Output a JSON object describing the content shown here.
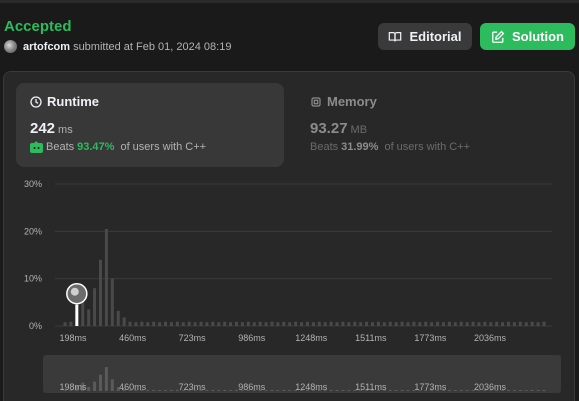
{
  "status": "Accepted",
  "submission": {
    "user": "artofcom",
    "text": "submitted at Feb 01, 2024 08:19"
  },
  "buttons": {
    "editorial": "Editorial",
    "solution": "Solution"
  },
  "runtime": {
    "title": "Runtime",
    "value": "242",
    "unit": "ms",
    "beats_label": "Beats",
    "beats_pct": "93.47%",
    "beats_suffix": "of users with C++"
  },
  "memory": {
    "title": "Memory",
    "value": "93.27",
    "unit": "MB",
    "beats_label": "Beats",
    "beats_pct": "31.99%",
    "beats_suffix": "of users with C++"
  },
  "colors": {
    "accent_green": "#2cbb5d",
    "bar": "#4a4a4a",
    "bar_mini": "#5a5a5a",
    "highlight_bar": "#ffffff"
  },
  "chart_data": {
    "type": "bar",
    "ylim": [
      0,
      30
    ],
    "yticks": [
      "30%",
      "20%",
      "10%",
      "0%"
    ],
    "ytick_values": [
      30,
      20,
      10,
      0
    ],
    "xticks": [
      "198ms",
      "460ms",
      "723ms",
      "986ms",
      "1248ms",
      "1511ms",
      "1773ms",
      "2036ms"
    ],
    "grid": true,
    "highlight_index": 2,
    "values": [
      0.8,
      0.9,
      4.5,
      7.2,
      3.5,
      8.0,
      14.0,
      20.5,
      10.0,
      3.2,
      1.8,
      0.9,
      0.8,
      0.9,
      0.8,
      0.9,
      0.8,
      0.9,
      0.8,
      0.9,
      0.8,
      0.9,
      0.8,
      0.9,
      0.8,
      0.9,
      0.8,
      0.9,
      0.8,
      0.9,
      0.8,
      0.9,
      0.8,
      0.9,
      0.8,
      0.9,
      0.8,
      0.9,
      0.8,
      0.9,
      0.8,
      0.9,
      0.8,
      0.9,
      0.8,
      0.9,
      0.8,
      0.9,
      0.8,
      0.9,
      0.8,
      0.9,
      0.8,
      0.9,
      0.8,
      0.9,
      0.8,
      0.9,
      0.8,
      0.9,
      0.8,
      0.9,
      0.8,
      0.9,
      0.8,
      0.9,
      0.8,
      0.9,
      0.8,
      0.9,
      0.8,
      0.9,
      0.8,
      0.9,
      0.8,
      0.9,
      0.8,
      0.9,
      0.8,
      0.9,
      0.8,
      0.9
    ]
  }
}
